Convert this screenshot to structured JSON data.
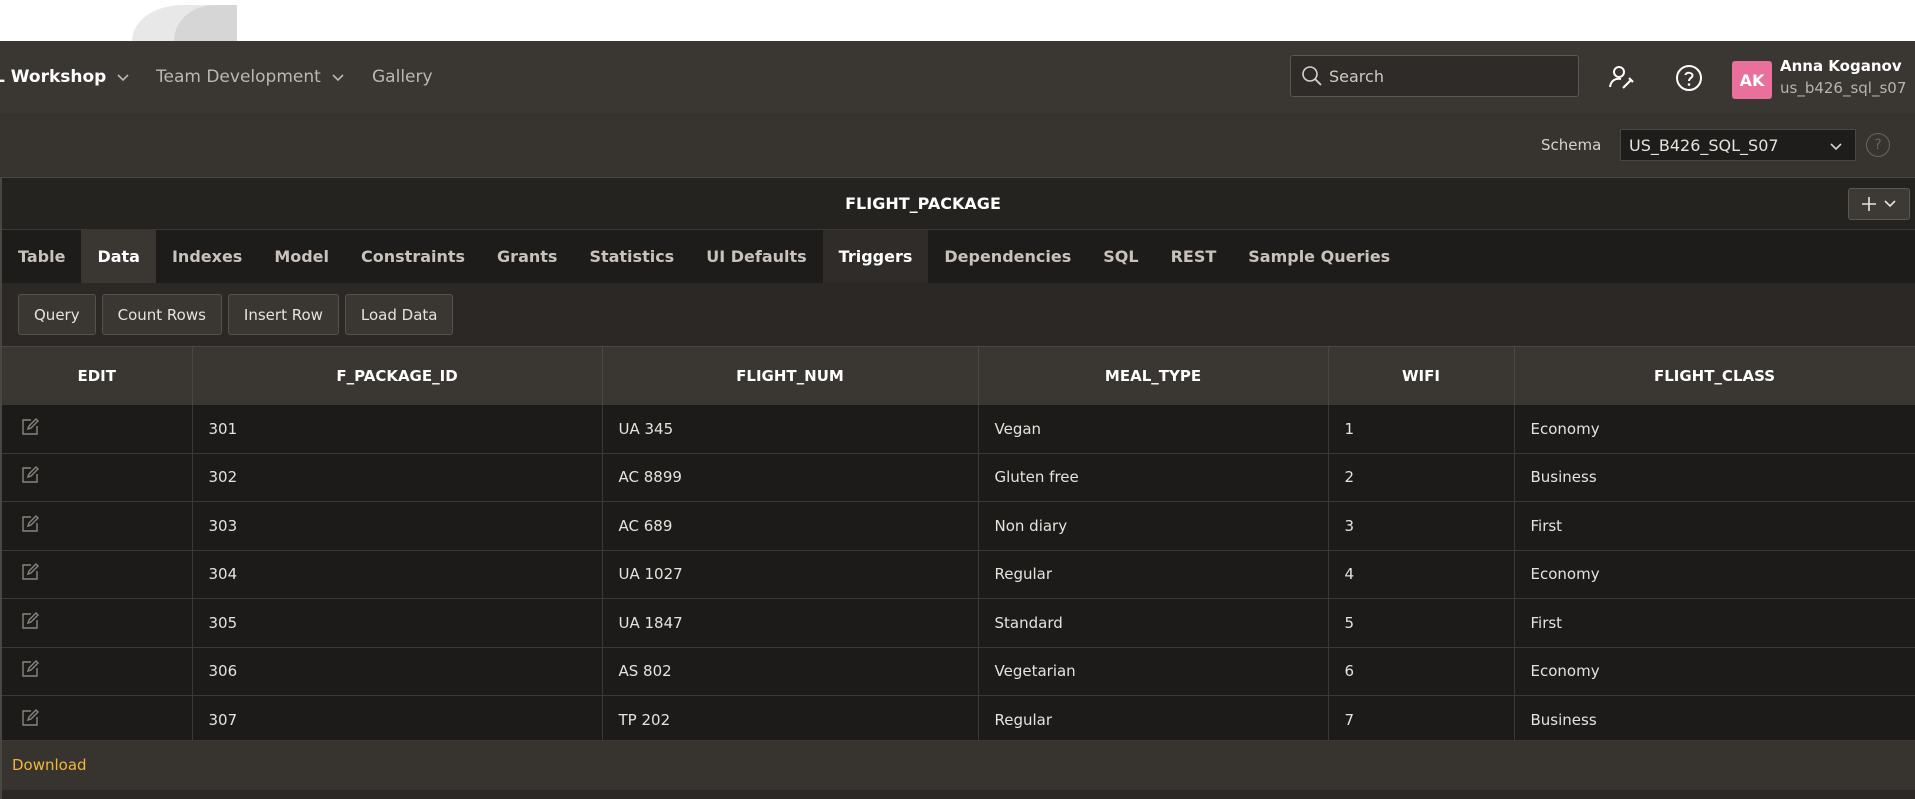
{
  "nav": {
    "items": [
      {
        "label": "L Workshop",
        "has_chevron": true,
        "active": true
      },
      {
        "label": "Team Development",
        "has_chevron": true,
        "active": false
      },
      {
        "label": "Gallery",
        "has_chevron": false,
        "active": false
      }
    ],
    "search": {
      "placeholder": "Search",
      "value": ""
    },
    "user": {
      "initials": "AK",
      "name": "Anna Koganov",
      "schema": "us_b426_sql_s07",
      "avatar_color": "#e8709a"
    }
  },
  "schema": {
    "label": "Schema",
    "selected": "US_B426_SQL_S07",
    "help_glyph": "?"
  },
  "panel": {
    "title": "FLIGHT_PACKAGE",
    "add_glyph": "+",
    "tabs": [
      {
        "label": "Table"
      },
      {
        "label": "Data"
      },
      {
        "label": "Indexes"
      },
      {
        "label": "Model"
      },
      {
        "label": "Constraints"
      },
      {
        "label": "Grants"
      },
      {
        "label": "Statistics"
      },
      {
        "label": "UI Defaults"
      },
      {
        "label": "Triggers"
      },
      {
        "label": "Dependencies"
      },
      {
        "label": "SQL"
      },
      {
        "label": "REST"
      },
      {
        "label": "Sample Queries"
      }
    ],
    "active_tab": "Data",
    "toolbar": {
      "query": "Query",
      "count_rows": "Count Rows",
      "insert_row": "Insert Row",
      "load_data": "Load Data"
    },
    "columns": [
      "EDIT",
      "F_PACKAGE_ID",
      "FLIGHT_NUM",
      "MEAL_TYPE",
      "WIFI",
      "FLIGHT_CLASS"
    ],
    "rows": [
      [
        "301",
        "UA 345",
        "Vegan",
        "1",
        "Economy"
      ],
      [
        "302",
        "AC 8899",
        "Gluten free",
        "2",
        "Business"
      ],
      [
        "303",
        "AC 689",
        "Non diary",
        "3",
        "First"
      ],
      [
        "304",
        "UA 1027",
        "Regular",
        "4",
        "Economy"
      ],
      [
        "305",
        "UA 1847",
        "Standard",
        "5",
        "First"
      ],
      [
        "306",
        "AS 802",
        "Vegetarian",
        "6",
        "Economy"
      ],
      [
        "307",
        "TP 202",
        "Regular",
        "7",
        "Business"
      ]
    ],
    "download": "Download"
  },
  "icons": {
    "search": "search-icon",
    "developer": "user-wrench-icon",
    "help": "help-icon",
    "edit": "edit-icon",
    "chevron": "chevron-down-icon",
    "add": "plus-icon"
  },
  "colors": {
    "accent": "#f0b73e",
    "avatar": "#e8709a",
    "nav_bg": "#3a3632"
  }
}
